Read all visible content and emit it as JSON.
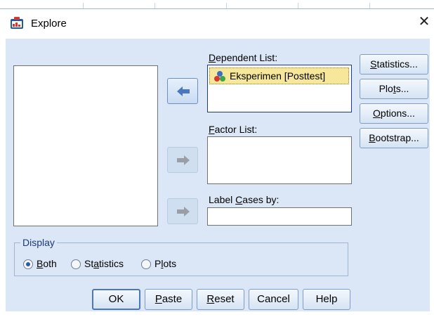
{
  "window": {
    "title": "Explore"
  },
  "labels": {
    "dependent_list": "Dependent List:",
    "factor_list": "Factor List:",
    "label_cases_by": "Label Cases by:"
  },
  "dependent_items": [
    {
      "label": "Eksperimen [Posttest]"
    }
  ],
  "side_buttons": {
    "statistics": "Statistics...",
    "plots": "Plots...",
    "options": "Options...",
    "bootstrap": "Bootstrap..."
  },
  "display": {
    "group_label": "Display",
    "options": [
      "Both",
      "Statistics",
      "Plots"
    ],
    "selected": "Both"
  },
  "bottom_buttons": {
    "ok": "OK",
    "paste": "Paste",
    "reset": "Reset",
    "cancel": "Cancel",
    "help": "Help"
  },
  "colors": {
    "dialog_bg": "#dbe7f6",
    "selected_item_bg": "#f6e79a",
    "active_arrow": "#4a78c0"
  }
}
